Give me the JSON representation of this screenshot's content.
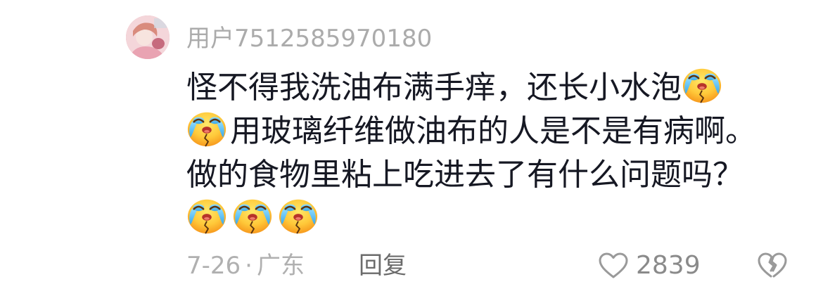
{
  "comment": {
    "avatar_icon": "user-avatar-photo",
    "username": "用户7512585970180",
    "lines": [
      [
        {
          "text": "怪不得我洗油布满手痒，还长小水泡"
        },
        {
          "emoji": "crying-emoji"
        }
      ],
      [
        {
          "emoji": "crying-emoji"
        },
        {
          "text": "用玻璃纤维做油布的人是不是有病啊。"
        }
      ],
      [
        {
          "text": "做的食物里粘上吃进去了有什么问题吗？"
        }
      ],
      [
        {
          "emoji": "crying-emoji"
        },
        {
          "emoji": "crying-emoji"
        },
        {
          "emoji": "crying-emoji"
        }
      ]
    ],
    "date": "7-26",
    "separator": "·",
    "location": "广东",
    "reply_label": "回复",
    "like_icon": "heart-outline-icon",
    "like_count": "2839",
    "dislike_icon": "broken-heart-icon"
  },
  "colors": {
    "background": "#ffffff",
    "comment_text": "#161823",
    "meta_text": "#ababab",
    "reply_text": "#6b6b6b",
    "icon": "#9a9a9a"
  }
}
